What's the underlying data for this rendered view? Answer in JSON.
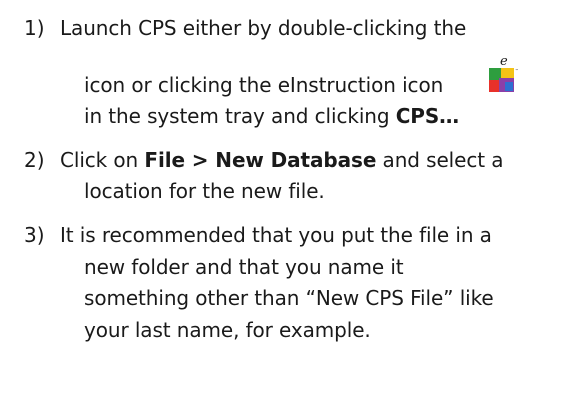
{
  "items": [
    {
      "number": "1)",
      "lines": [
        {
          "text": "Launch CPS either by double-clicking the"
        },
        {
          "text": "icon or clicking the eInstruction icon"
        },
        {
          "pre": "in the system tray and clicking ",
          "bold": "CPS…"
        }
      ]
    },
    {
      "number": "2)",
      "lines": [
        {
          "pre": "Click on ",
          "bold": "File > New Database",
          "post": " and select a"
        },
        {
          "text": "location for the new file."
        }
      ]
    },
    {
      "number": "3)",
      "lines": [
        {
          "text": "It is recommended that you put the file in a"
        },
        {
          "text": "new folder and that you name it"
        },
        {
          "text": "something other than “New CPS File” like"
        },
        {
          "text": "your last name, for example."
        }
      ]
    }
  ],
  "icon": {
    "name": "einstruction-icon",
    "colors": [
      "#2e9e3f",
      "#e8312a",
      "#f4c316",
      "#8b3fa8",
      "#2f6fd1"
    ]
  }
}
